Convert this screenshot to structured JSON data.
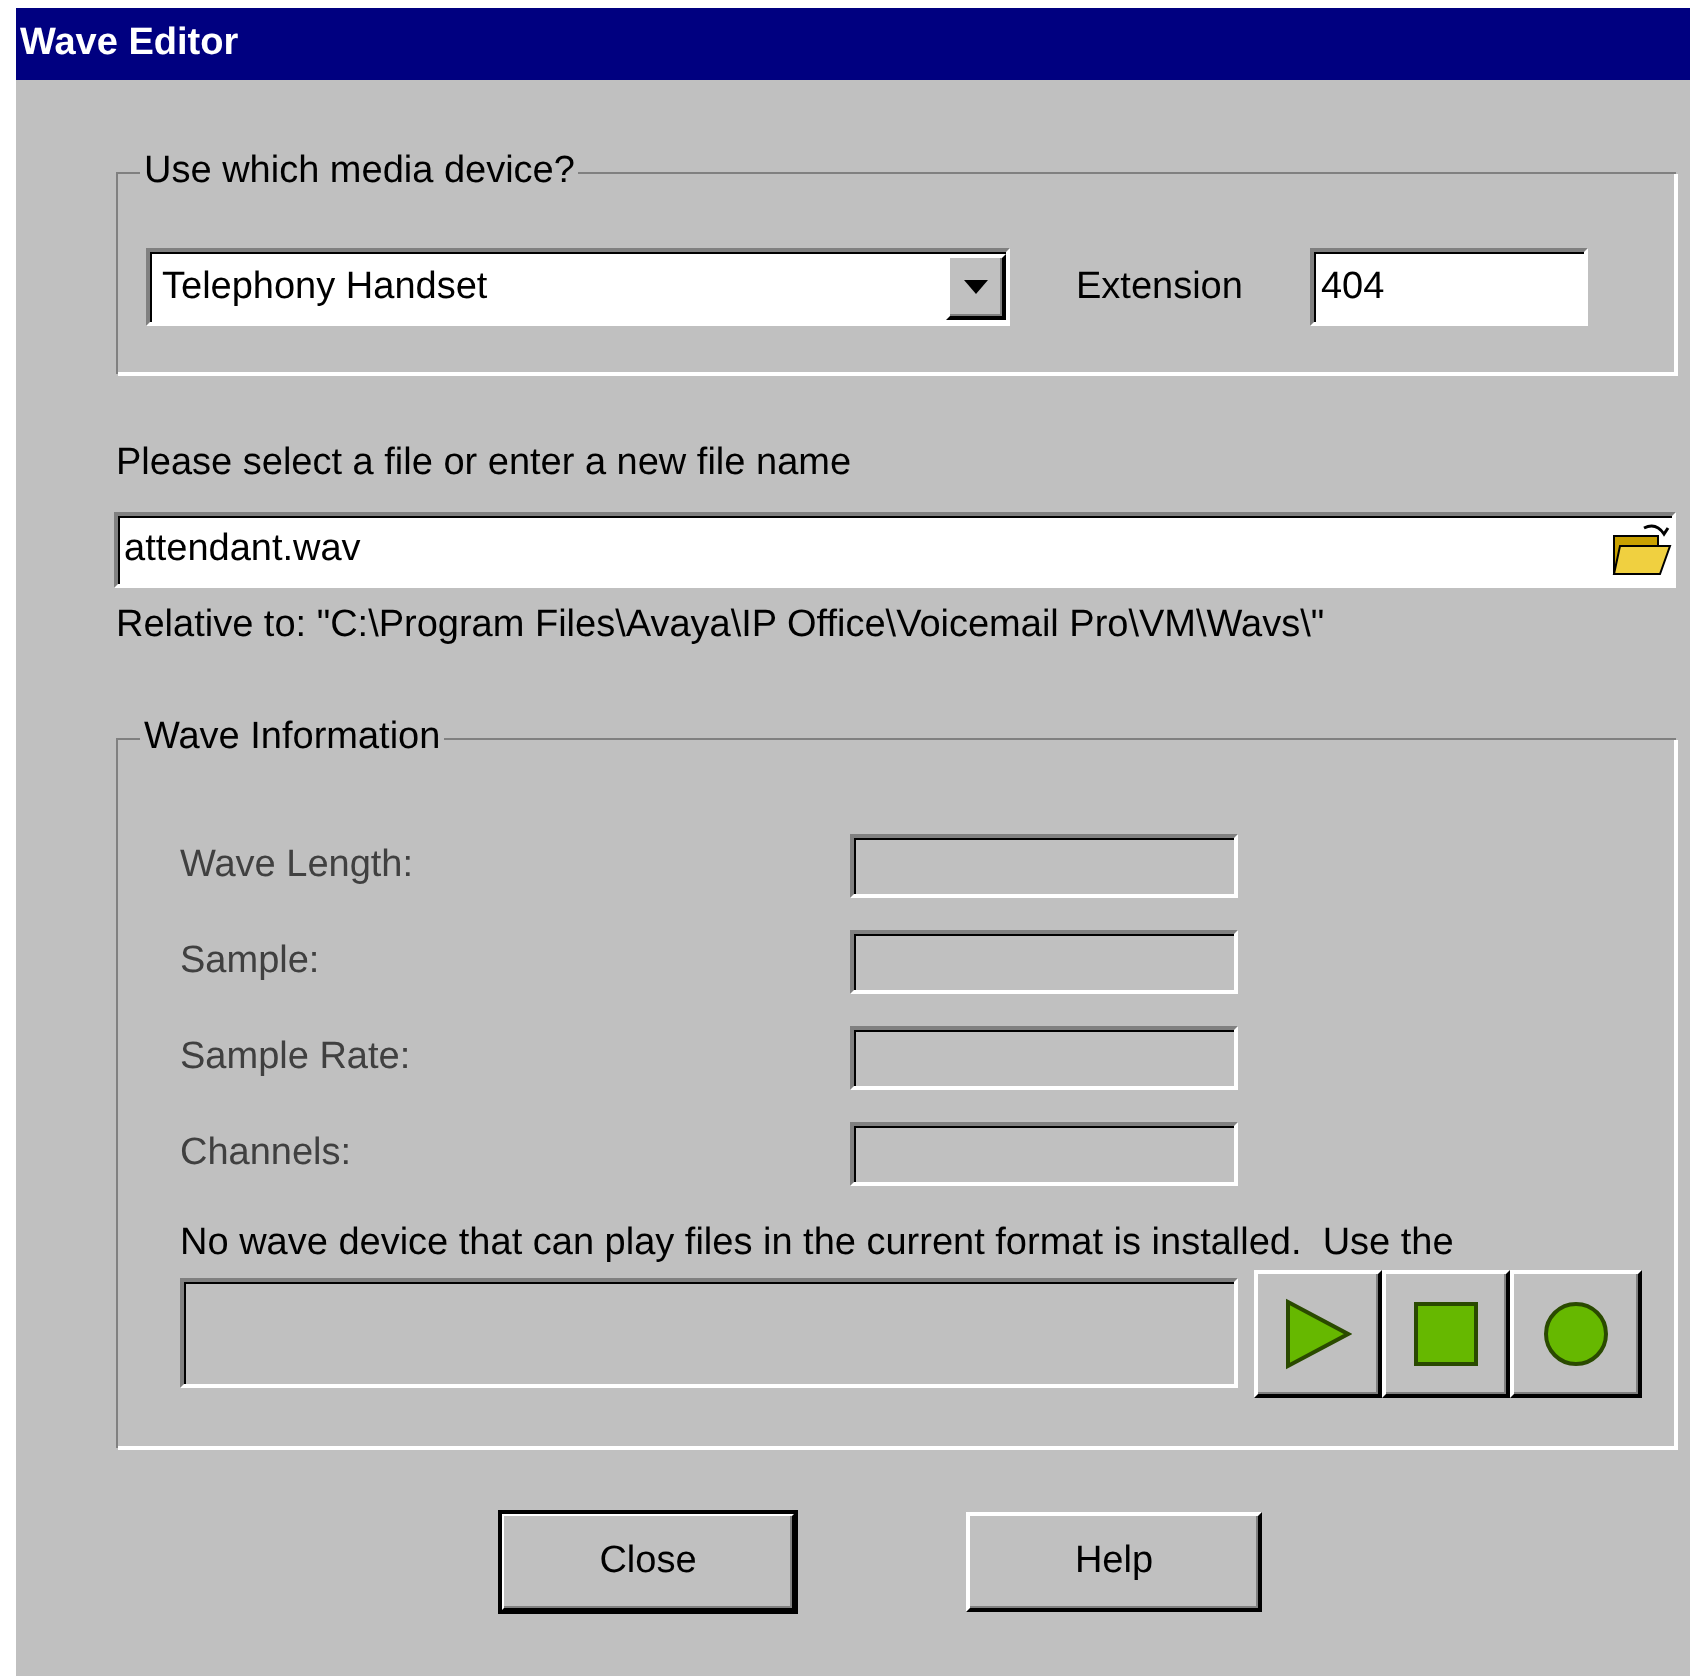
{
  "window": {
    "title": "Wave Editor"
  },
  "media_device": {
    "legend": "Use which media device?",
    "device": {
      "value": "Telephony Handset"
    },
    "extension": {
      "label": "Extension",
      "value": "404"
    }
  },
  "file": {
    "prompt": "Please select a file or enter a new file name",
    "value": "attendant.wav",
    "relative_to": "Relative to: \"C:\\Program Files\\Avaya\\IP Office\\Voicemail Pro\\VM\\Wavs\\\""
  },
  "wave_information": {
    "legend": "Wave Information",
    "fields": [
      {
        "label": "Wave Length:",
        "disabled": true
      },
      {
        "label": "Sample:",
        "disabled": true
      },
      {
        "label": "Sample Rate:",
        "disabled": true
      },
      {
        "label": "Channels:",
        "disabled": true
      }
    ],
    "message": "No wave device that can play files in the current format is installed.  Use the",
    "controls": [
      {
        "kind": "play"
      },
      {
        "kind": "stop"
      },
      {
        "kind": "record"
      }
    ]
  },
  "buttons": [
    {
      "label": "Close",
      "default": true
    },
    {
      "label": "Help",
      "default": false
    }
  ]
}
